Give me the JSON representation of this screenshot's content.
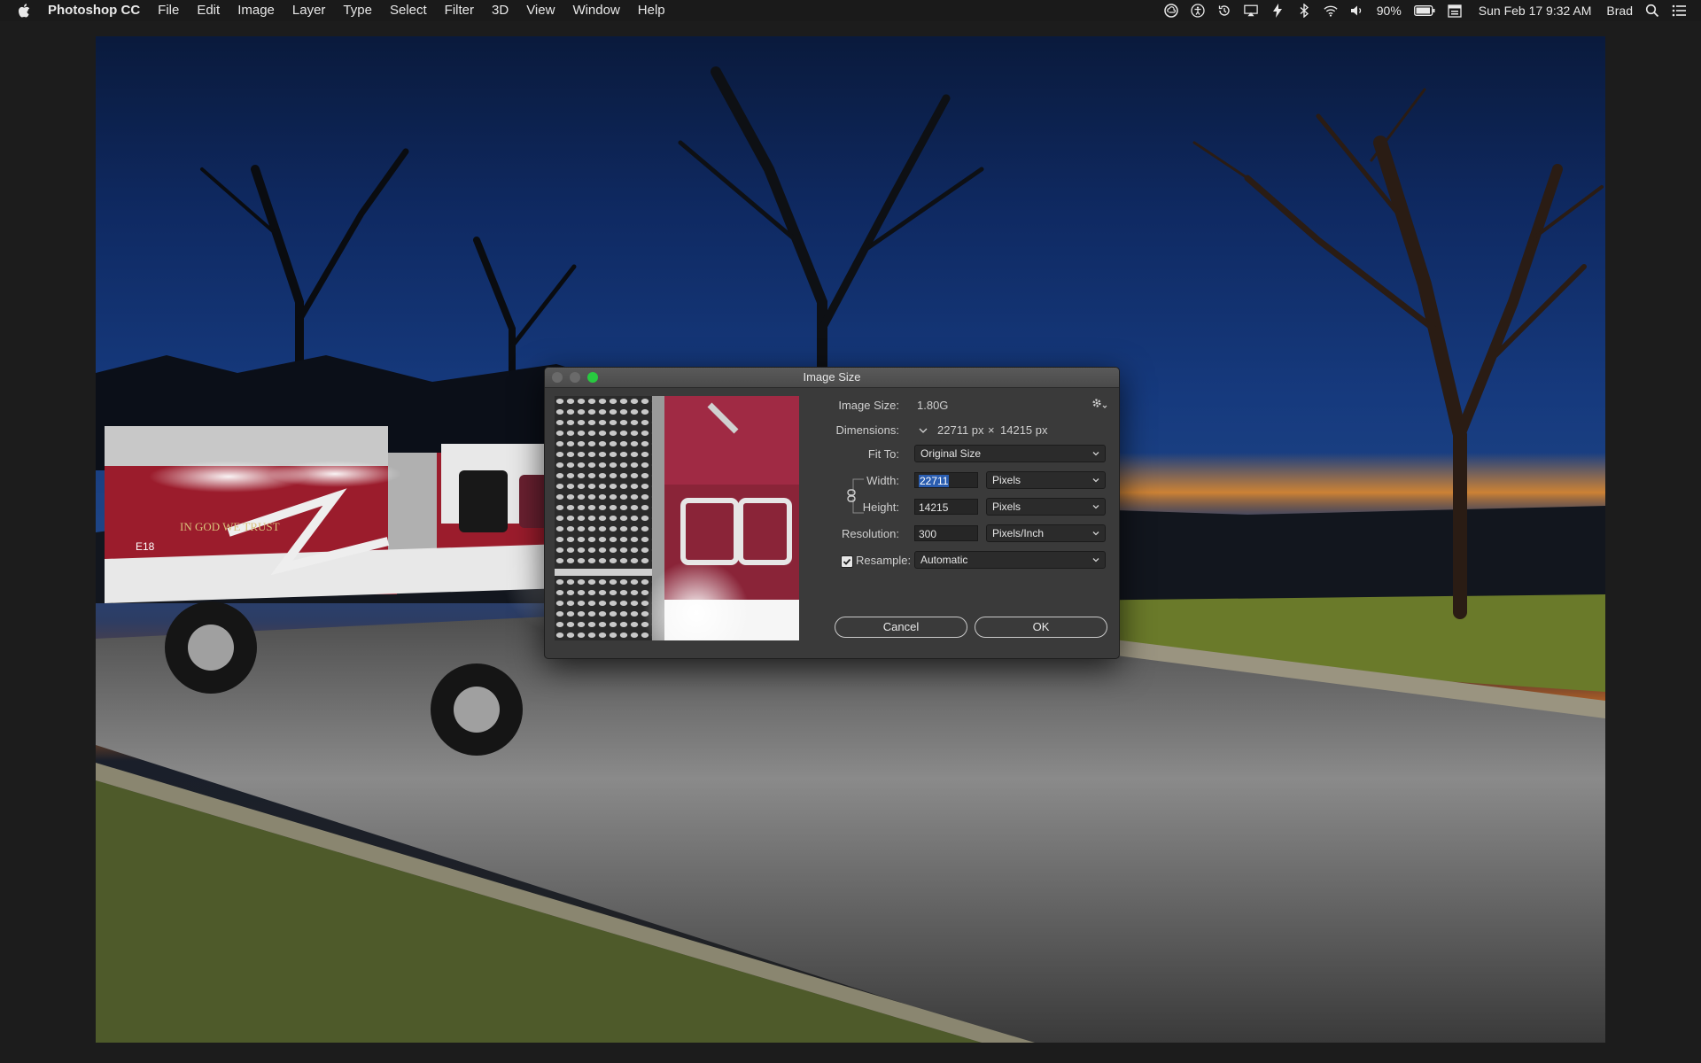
{
  "menubar": {
    "app_name": "Photoshop CC",
    "items": [
      "File",
      "Edit",
      "Image",
      "Layer",
      "Type",
      "Select",
      "Filter",
      "3D",
      "View",
      "Window",
      "Help"
    ],
    "battery": "90%",
    "datetime": "Sun Feb 17  9:32 AM",
    "user": "Brad"
  },
  "photo": {
    "truck_slogan": "IN GOD WE TRUST",
    "truck_unit": "E18"
  },
  "dialog": {
    "title": "Image Size",
    "image_size_label": "Image Size:",
    "image_size_value": "1.80G",
    "dimensions_label": "Dimensions:",
    "dimensions_w": "22711 px",
    "dimensions_x": "×",
    "dimensions_h": "14215 px",
    "fit_to_label": "Fit To:",
    "fit_to_value": "Original Size",
    "width_label": "Width:",
    "width_value": "22711",
    "width_unit": "Pixels",
    "height_label": "Height:",
    "height_value": "14215",
    "height_unit": "Pixels",
    "resolution_label": "Resolution:",
    "resolution_value": "300",
    "resolution_unit": "Pixels/Inch",
    "resample_label": "Resample:",
    "resample_checked": true,
    "resample_value": "Automatic",
    "cancel_label": "Cancel",
    "ok_label": "OK"
  },
  "colors": {
    "accent_selection": "#2a5db0",
    "zoom_button": "#28c940",
    "truck_red": "#9b1c2c"
  }
}
